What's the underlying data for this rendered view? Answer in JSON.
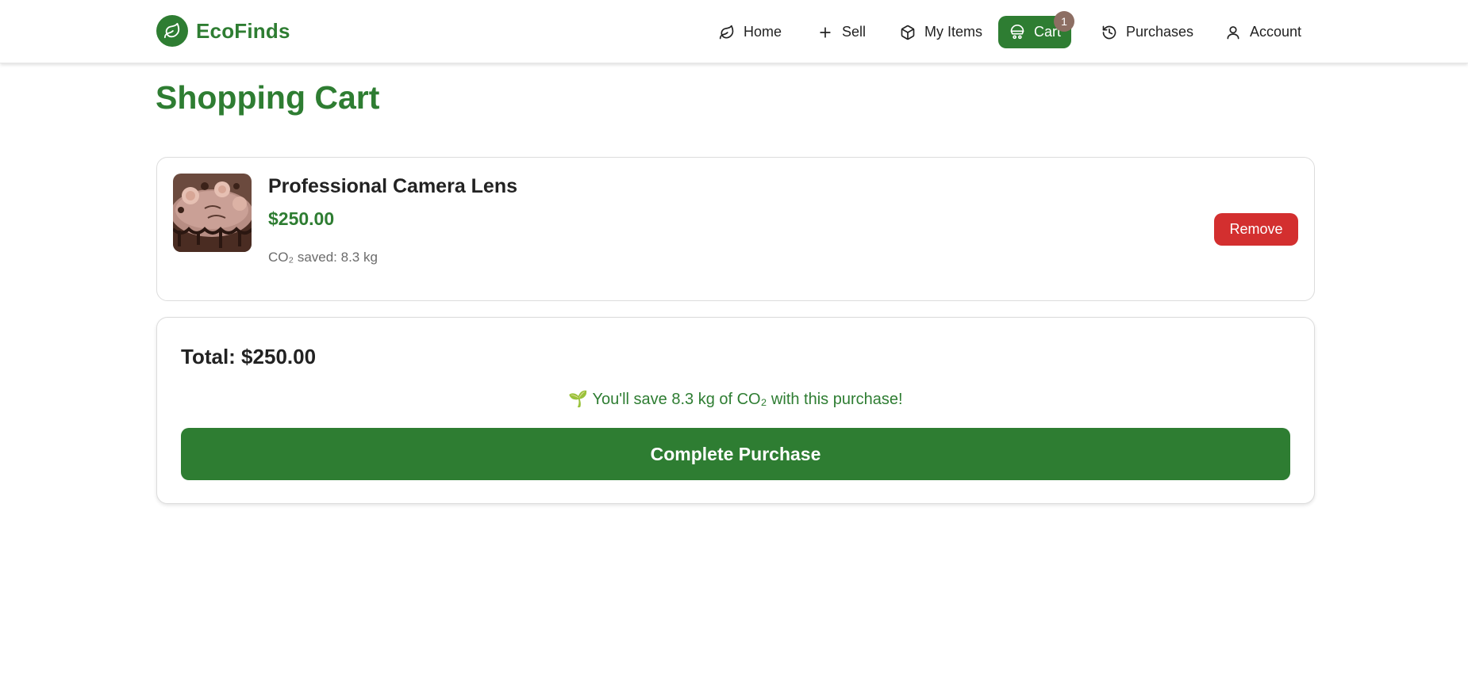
{
  "brand": {
    "name": "EcoFinds",
    "logo_icon": "leaf-icon",
    "color": "#2e7d32"
  },
  "nav": [
    {
      "label": "Home",
      "icon": "leaf-icon",
      "active": false
    },
    {
      "label": "Sell",
      "icon": "plus-icon",
      "active": false
    },
    {
      "label": "My Items",
      "icon": "box-icon",
      "active": false
    },
    {
      "label": "Cart",
      "icon": "cart-icon",
      "active": true,
      "badge": "1"
    },
    {
      "label": "Purchases",
      "icon": "history-icon",
      "active": false
    },
    {
      "label": "Account",
      "icon": "user-icon",
      "active": false
    }
  ],
  "page": {
    "title": "Shopping Cart"
  },
  "cart": {
    "items": [
      {
        "name": "Professional Camera Lens",
        "price": "$250.00",
        "co2": "CO₂ saved: 8.3 kg",
        "image_icon": "product-thumbnail",
        "remove_label": "Remove"
      }
    ]
  },
  "summary": {
    "total": "Total: $250.00",
    "savings": "🌱 You'll save 8.3 kg of CO₂ with this purchase!",
    "purchase_label": "Complete Purchase"
  },
  "colors": {
    "accent": "#2e7d32",
    "danger": "#d32f2f",
    "badge": "#8d6e63",
    "muted": "#6b6b6b"
  }
}
